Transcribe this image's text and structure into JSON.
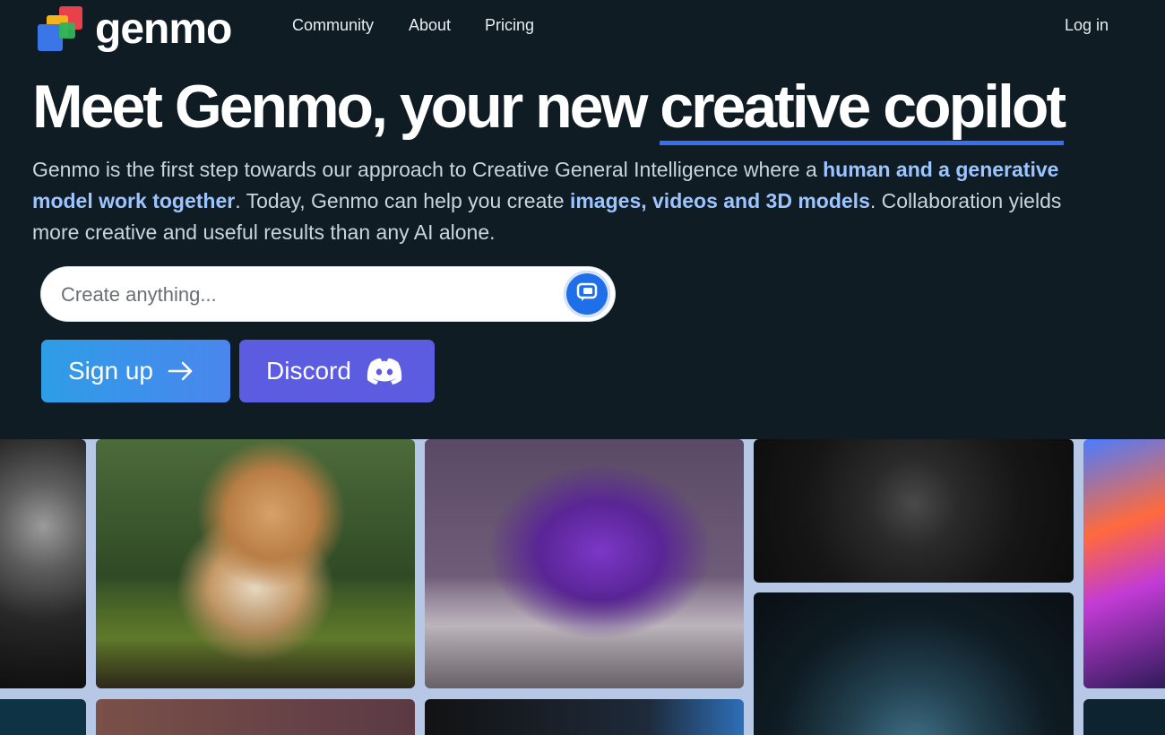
{
  "brand": {
    "name": "genmo"
  },
  "nav": {
    "links": [
      {
        "label": "Community"
      },
      {
        "label": "About"
      },
      {
        "label": "Pricing"
      }
    ],
    "login": "Log in"
  },
  "hero": {
    "title_plain": "Meet Genmo, your new ",
    "title_highlight": "creative copilot",
    "desc": {
      "p1": "Genmo is the first step towards our approach to Creative General Intelligence where a ",
      "em1": "human and a generative model work together",
      "p2": ". Today, Genmo can help you create ",
      "em2": "images, videos and 3D models",
      "p3": ". Collaboration yields more creative and useful results than any AI alone."
    }
  },
  "search": {
    "placeholder": "Create anything..."
  },
  "buttons": {
    "signup": "Sign up",
    "discord": "Discord"
  },
  "colors": {
    "background": "#101c24",
    "accent_blue": "#1f6fe8",
    "highlight_text": "#9cc4ff",
    "discord": "#5b5ce0"
  },
  "icons": {
    "search_button": "chat-bubbles-icon",
    "signup": "arrow-right-icon",
    "discord": "discord-icon"
  },
  "gallery": {
    "items": [
      {
        "name": "stone-statue"
      },
      {
        "name": "forest-kitten"
      },
      {
        "name": "purple-shoe"
      },
      {
        "name": "dark-flower"
      },
      {
        "name": "eye-closeup"
      },
      {
        "name": "neon-abstract"
      }
    ]
  }
}
